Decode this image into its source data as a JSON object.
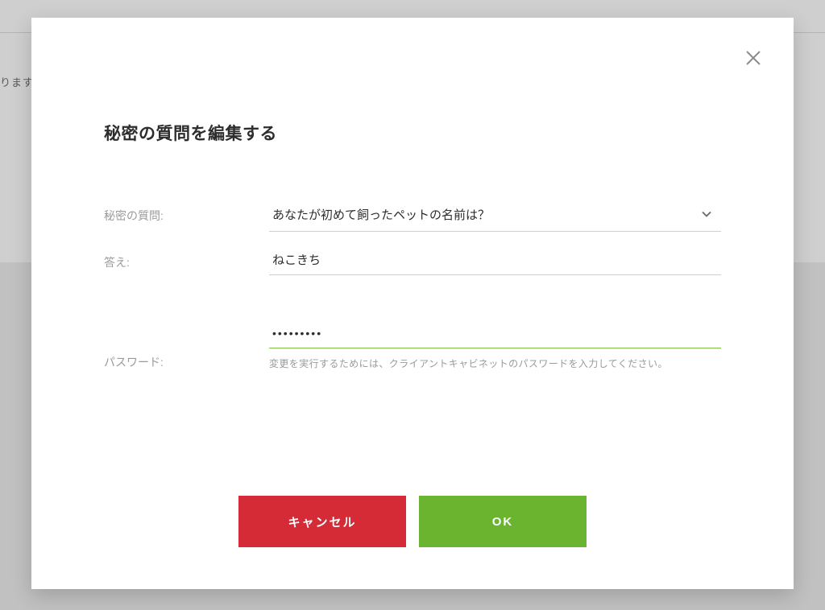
{
  "background": {
    "partial_text": "ります"
  },
  "modal": {
    "title": "秘密の質問を編集する",
    "labels": {
      "question": "秘密の質問:",
      "answer": "答え:",
      "password": "パスワード:"
    },
    "question_select": {
      "selected": "あなたが初めて飼ったペットの名前は？"
    },
    "answer_value": "ねこきち",
    "password_value": "•••••••••",
    "password_hint": "変更を実行するためには、クライアントキャビネットのパスワードを入力してください。",
    "buttons": {
      "cancel": "キャンセル",
      "ok": "OK"
    }
  }
}
